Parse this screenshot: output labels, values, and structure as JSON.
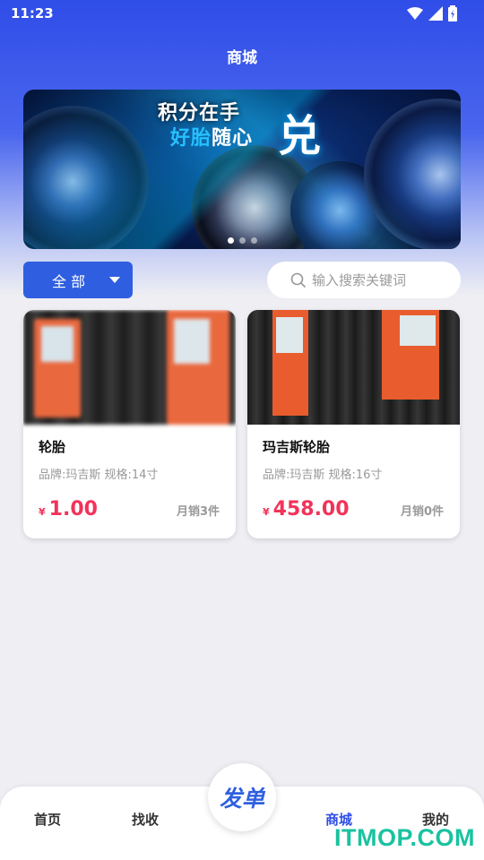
{
  "status": {
    "time": "11:23"
  },
  "page": {
    "title": "商城"
  },
  "banner": {
    "line1": "积分在手",
    "line2_highlight": "好胎",
    "line2_rest": "随心",
    "big": "兑",
    "slides": 3,
    "active_slide": 0
  },
  "filter": {
    "category": "全 部"
  },
  "search": {
    "placeholder": "输入搜索关键词"
  },
  "products": [
    {
      "name": "轮胎",
      "spec": "品牌:玛吉斯  规格:14寸",
      "currency": "¥",
      "price": "1.00",
      "sales": "月销3件"
    },
    {
      "name": "玛吉斯轮胎",
      "spec": "品牌:玛吉斯  规格:16寸",
      "currency": "¥",
      "price": "458.00",
      "sales": "月销0件"
    }
  ],
  "nav": {
    "home": "首页",
    "find": "找收",
    "publish": "发单",
    "mall": "商城",
    "mine": "我的"
  },
  "watermark": "ITMOP.COM",
  "colors": {
    "accent": "#2f4de8",
    "price": "#f2335a"
  }
}
